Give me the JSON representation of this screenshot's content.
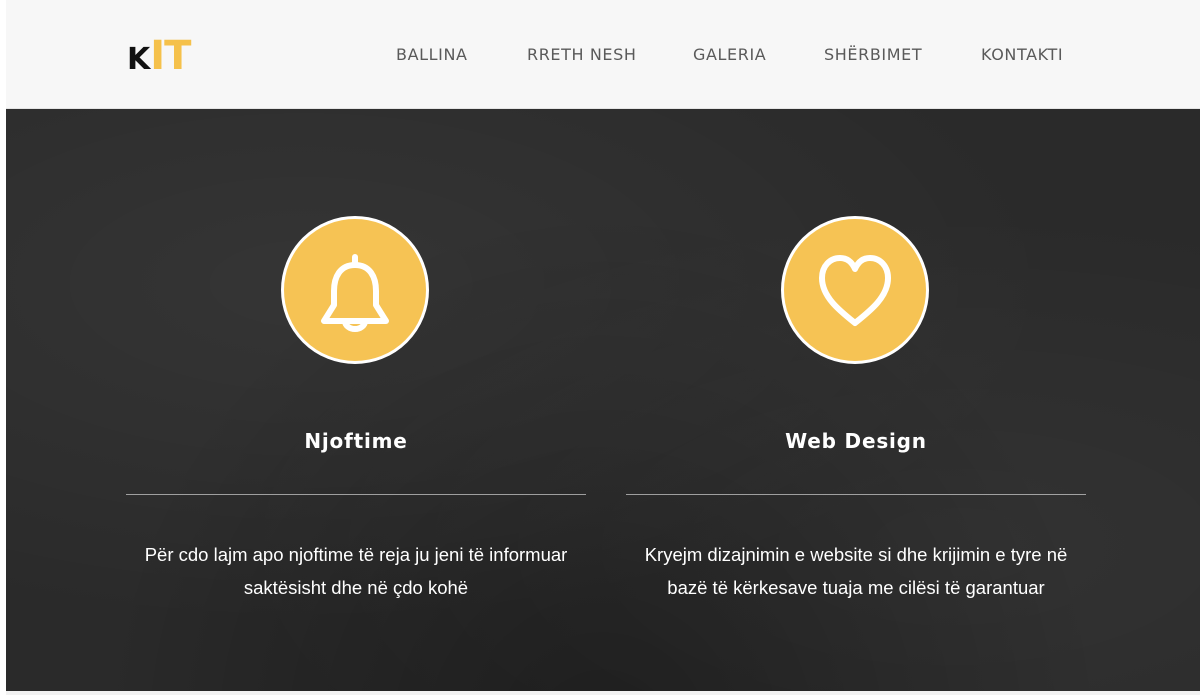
{
  "logo": {
    "k": "K",
    "it": "IT"
  },
  "nav": {
    "items": [
      {
        "label": "BALLINA"
      },
      {
        "label": "RRETH NESH"
      },
      {
        "label": "GALERIA"
      },
      {
        "label": "SHËRBIMET"
      },
      {
        "label": "KONTAKTI"
      }
    ]
  },
  "features": [
    {
      "icon": "bell-icon",
      "title": "Njoftime",
      "text_lines": [
        "Për cdo lajm apo njoftime të reja ju jeni të informuar",
        "saktësisht dhe në çdo kohë"
      ]
    },
    {
      "icon": "heart-icon",
      "title": "Web Design",
      "text_lines": [
        "Kryejm dizajnimin e website si dhe krijimin e tyre në",
        "bazë të kërkesave tuaja me cilësi të garantuar"
      ]
    }
  ],
  "colors": {
    "accent": "#f6c354",
    "header_bg": "#f7f7f7",
    "hero_bg": "#2a2a2a",
    "nav_text": "#5a5a5a"
  }
}
